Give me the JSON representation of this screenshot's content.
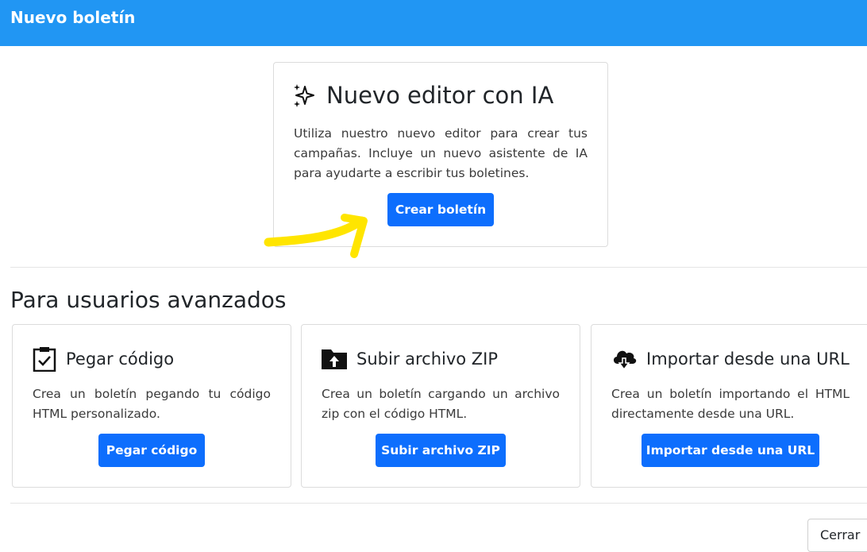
{
  "header": {
    "title": "Nuevo boletín",
    "background": "#2196f3"
  },
  "ai_card": {
    "title": "Nuevo editor con IA",
    "icon": "sparkles-icon",
    "description": "Utiliza nuestro nuevo editor para crear tus campañas. Incluye un nuevo asistente de IA para ayudarte a escribir tus boletines.",
    "button_label": "Crear boletín"
  },
  "advanced": {
    "title": "Para usuarios avanzados",
    "cards": [
      {
        "title": "Pegar código",
        "icon": "clipboard-check-icon",
        "description": "Crea un boletín pegando tu código HTML personalizado.",
        "button_label": "Pegar código"
      },
      {
        "title": "Subir archivo ZIP",
        "icon": "folder-upload-icon",
        "description": "Crea un boletín cargando un archivo zip con el código HTML.",
        "button_label": "Subir archivo ZIP"
      },
      {
        "title": "Importar desde una URL",
        "icon": "cloud-download-icon",
        "description": "Crea un boletín importando el HTML directamente desde una URL.",
        "button_label": "Importar desde una URL"
      }
    ]
  },
  "footer": {
    "close_label": "Cerrar"
  },
  "colors": {
    "primary_button": "#0d6efd",
    "highlight_arrow": "#ffe500"
  }
}
